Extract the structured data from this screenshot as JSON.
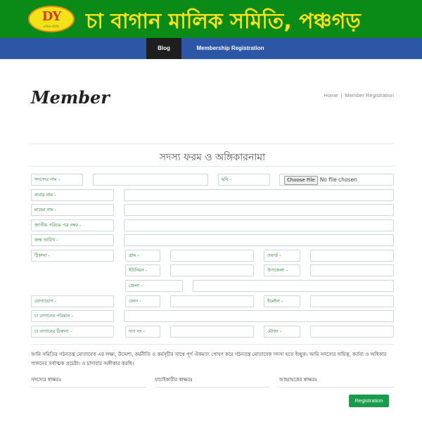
{
  "banner": {
    "logo_text": "DY",
    "logo_subtext": "মালিক সমিতি",
    "title": "চা বাগান মালিক সমিতি, পঞ্চগড়",
    "background": "#0a8a17",
    "title_color": "#ffe21a"
  },
  "nav": {
    "items": [
      {
        "label": "Blog",
        "active": true
      },
      {
        "label": "Membership Registration",
        "active": false
      }
    ],
    "background": "#2c56a6"
  },
  "page": {
    "title": "Member",
    "breadcrumb": {
      "home": "Home",
      "separator": "|",
      "current": "Member Registration"
    }
  },
  "form": {
    "heading": "সদস্য ফরম ও অঙ্গিকারনামা",
    "labels": {
      "member_name": "সদস্যের নাম -",
      "photo": "ছবি -",
      "father_name": "বাবার নাম -",
      "mother_name": "মায়ের নাম -",
      "nid": "জাতীয় পরিচয় পত্র নম্বর -",
      "dob": "জন্ম তারিখ -",
      "address": "ঠিকানা -",
      "village": "গ্রাম -",
      "ward": "ওয়ার্ড -",
      "union": "ইউনিয়ন -",
      "upazila": "উপজেলা -",
      "district": "জেলা -",
      "contact": "যোগাযোগ -",
      "phone": "ফোন -",
      "email": "ইমেইল -",
      "garden_size": "চা বাগানের পরিমান -",
      "garden_address": "চা বাগানের ঠিকানা -",
      "dag_no": "দাগ নং -",
      "mouza": "মৌজা -"
    },
    "file_input": {
      "button_label": "Choose File",
      "status": "No file chosen"
    },
    "declaration": "আমি সমিতির গঠনতন্ত্র মোতাবেক এর লক্ষ্য, উদ্দেশ্য, কর্মনীতি ও কর্মসূচীর সাথে পূর্ণ ঐকমত্য পোষণ করে গঠনতন্ত্র মোতাবেক সদস্য হতে ইচ্ছুক। আমি সদস্যের দায়িত্ব, কর্তব্য ও অধিকার পালনের সর্বাত্মক প্রচেষ্টা। ও চাদাবার অঙ্গীকার করছি।",
    "signatures": {
      "member": "সদস্যের স্বাক্ষরঃ",
      "verifier": "যাচাইকারীর স্বাক্ষরঃ",
      "convener": "আহ্বায়কের স্বাক্ষরঃ"
    },
    "submit_label": "Registration",
    "submit_color": "#1b9a4b"
  }
}
